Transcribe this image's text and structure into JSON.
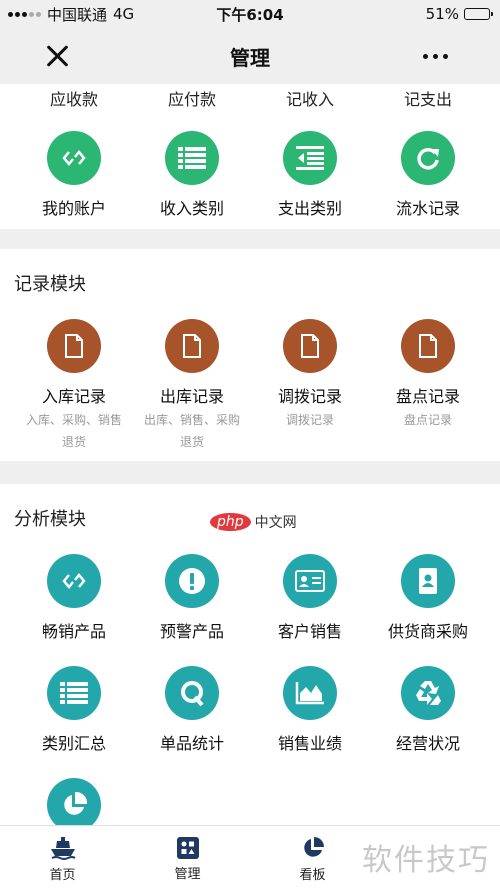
{
  "status": {
    "carrier": "中国联通",
    "network": "4G",
    "time": "下午6:04",
    "battery": "51%",
    "battery_level": 0.51
  },
  "nav": {
    "title": "管理"
  },
  "top_row": [
    "应收款",
    "应付款",
    "记收入",
    "记支出"
  ],
  "finance": [
    {
      "label": "我的账户",
      "icon": "link-icon"
    },
    {
      "label": "收入类别",
      "icon": "list-icon"
    },
    {
      "label": "支出类别",
      "icon": "outdent-icon"
    },
    {
      "label": "流水记录",
      "icon": "refresh-icon"
    }
  ],
  "records": {
    "title": "记录模块",
    "items": [
      {
        "label": "入库记录",
        "sub1": "入库、采购、销售",
        "sub2": "退货"
      },
      {
        "label": "出库记录",
        "sub1": "出库、销售、采购",
        "sub2": "退货"
      },
      {
        "label": "调拨记录",
        "sub1": "调拨记录",
        "sub2": ""
      },
      {
        "label": "盘点记录",
        "sub1": "盘点记录",
        "sub2": ""
      }
    ]
  },
  "analysis": {
    "title": "分析模块",
    "items": [
      {
        "label": "畅销产品",
        "icon": "link-icon"
      },
      {
        "label": "预警产品",
        "icon": "alert-icon"
      },
      {
        "label": "客户销售",
        "icon": "id-card-icon"
      },
      {
        "label": "供货商采购",
        "icon": "contacts-icon"
      },
      {
        "label": "类别汇总",
        "icon": "list-icon"
      },
      {
        "label": "单品统计",
        "icon": "q-icon"
      },
      {
        "label": "销售业绩",
        "icon": "area-chart-icon"
      },
      {
        "label": "经营状况",
        "icon": "recycle-icon"
      },
      {
        "label": "",
        "icon": "pie-chart-icon"
      }
    ]
  },
  "tabs": [
    {
      "label": "首页",
      "icon": "ship-icon"
    },
    {
      "label": "管理",
      "icon": "apps-icon"
    },
    {
      "label": "看板",
      "icon": "pie-icon"
    }
  ],
  "watermark": {
    "logo": "php",
    "cn": "中文网",
    "text": "软件技巧"
  },
  "colors": {
    "green": "#2bb673",
    "brown": "#a8542a",
    "teal": "#23a7ab"
  }
}
